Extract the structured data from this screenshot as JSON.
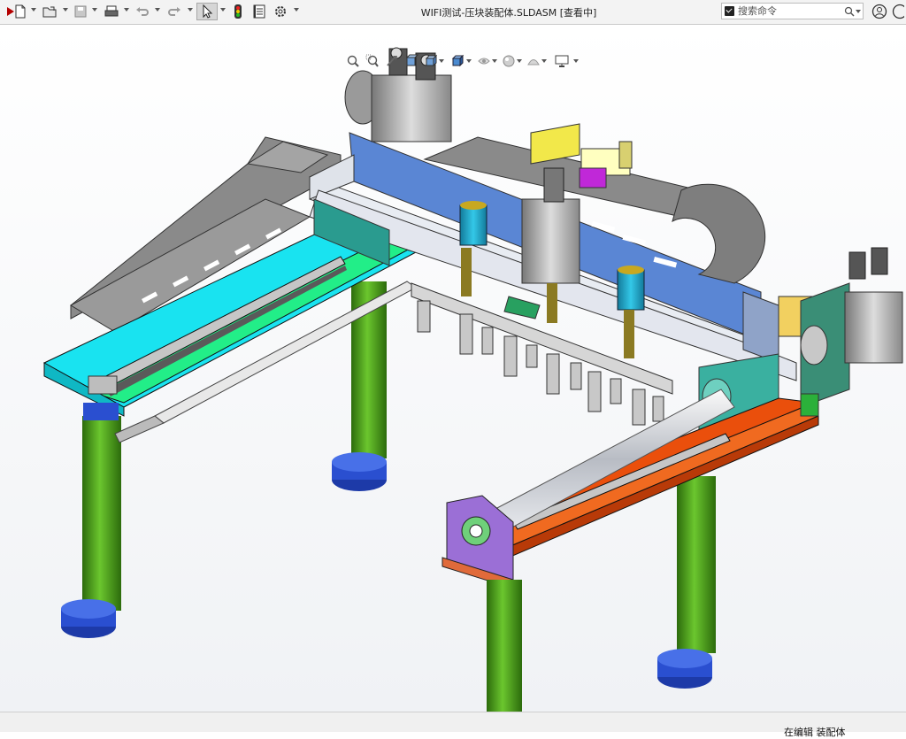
{
  "window": {
    "title": "WIFI测试-压块装配体.SLDASM [查看中]"
  },
  "search": {
    "placeholder": "搜索命令"
  },
  "toolbar": {
    "buttons": [
      "new-icon",
      "open-icon",
      "save-icon",
      "print-icon",
      "undo-icon",
      "redo-icon",
      "select-icon",
      "traffic-light-icon",
      "file-properties-icon",
      "options-icon"
    ]
  },
  "heads_up_toolbar": {
    "buttons": [
      "zoom-to-fit-icon",
      "zoom-area-icon",
      "previous-view-icon",
      "section-view-icon",
      "view-orientation-icon",
      "display-style-icon",
      "hide-show-icon",
      "appearance-icon",
      "scene-icon",
      "display-settings-icon"
    ]
  },
  "status": {
    "text": "在编辑 装配体"
  },
  "colors": {
    "frame_gray": "#8c8c8c",
    "rail_cyan": "#19e3f0",
    "rail_green": "#22ee88",
    "beam_blue": "#5a86d4",
    "plate_white": "#e8ecf2",
    "orange": "#ea4f0c",
    "purple": "#9b6fd6",
    "leg_green": "#3e8f14",
    "foot_blue": "#2340b8",
    "yellow": "#f2e84a",
    "magenta": "#c028d8",
    "teal": "#2a9b8f"
  }
}
